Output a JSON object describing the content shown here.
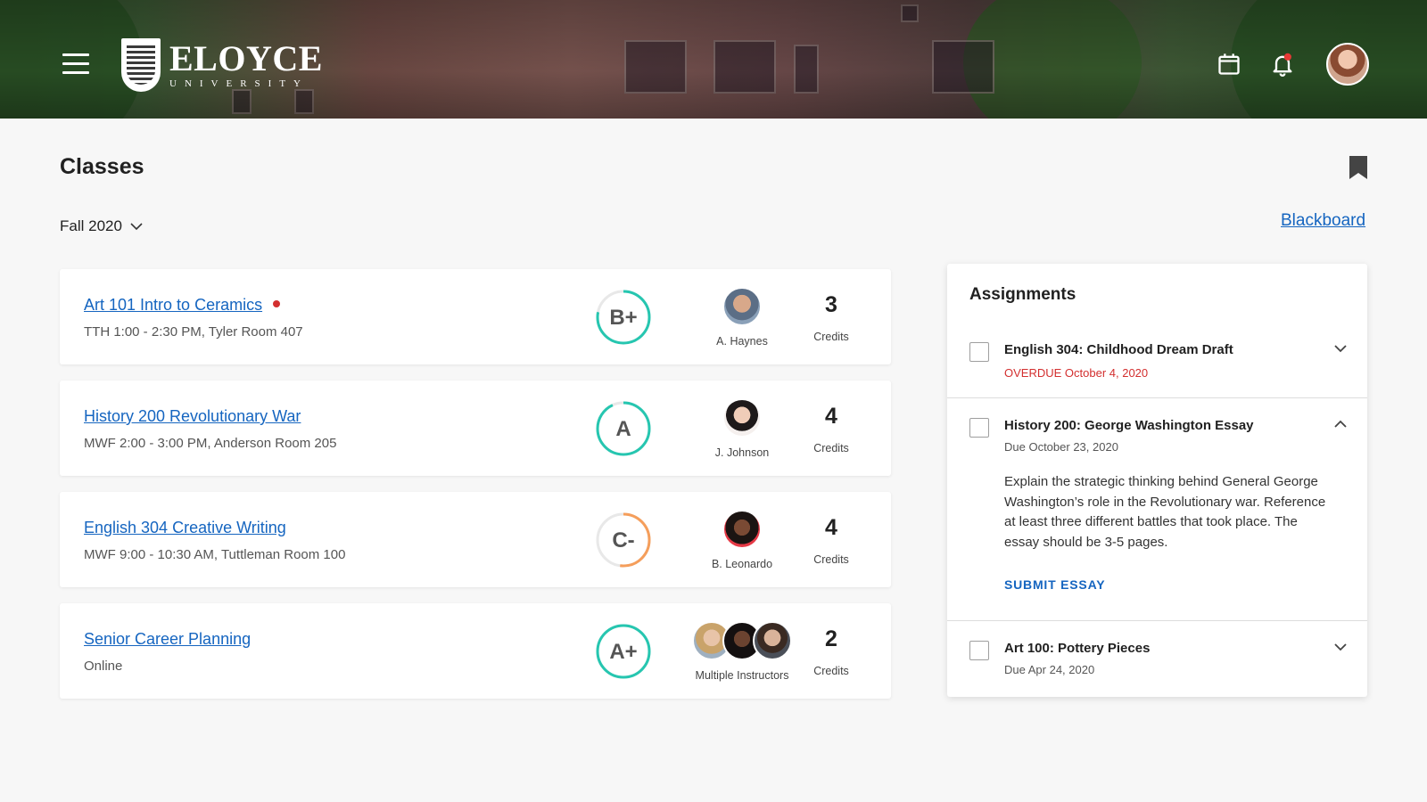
{
  "header": {
    "logo_name": "ELOYCE",
    "logo_sub": "UNIVERSITY"
  },
  "page": {
    "title": "Classes",
    "term": "Fall 2020",
    "blackboard_link": "Blackboard"
  },
  "classes": [
    {
      "name": "Art 101 Intro to Ceramics",
      "schedule": "TTH 1:00 - 2:30 PM, Tyler Room 407",
      "grade": "B+",
      "grade_progress": 0.78,
      "grade_color": "#26c6b0",
      "instructor": "A. Haynes",
      "credits": "3",
      "credits_label": "Credits",
      "has_alert": true
    },
    {
      "name": "History 200 Revolutionary War",
      "schedule": "MWF 2:00 - 3:00 PM, Anderson Room 205",
      "grade": "A",
      "grade_progress": 0.93,
      "grade_color": "#26c6b0",
      "instructor": "J. Johnson",
      "credits": "4",
      "credits_label": "Credits",
      "has_alert": false
    },
    {
      "name": "English 304 Creative Writing",
      "schedule": "MWF 9:00 - 10:30 AM, Tuttleman Room 100",
      "grade": "C-",
      "grade_progress": 0.52,
      "grade_color": "#f59e5b",
      "instructor": "B. Leonardo",
      "credits": "4",
      "credits_label": "Credits",
      "has_alert": false
    },
    {
      "name": "Senior Career Planning",
      "schedule": "Online",
      "grade": "A+",
      "grade_progress": 1.0,
      "grade_color": "#26c6b0",
      "instructor": "Multiple Instructors",
      "credits": "2",
      "credits_label": "Credits",
      "has_alert": false
    }
  ],
  "assignments": {
    "title": "Assignments",
    "items": [
      {
        "title": "English 304: Childhood Dream Draft",
        "due": "OVERDUE October 4, 2020",
        "overdue": true,
        "expanded": false
      },
      {
        "title": "History 200: George Washington Essay",
        "due": "Due October 23, 2020",
        "overdue": false,
        "expanded": true,
        "description": "Explain the strategic thinking behind General George Washington’s role in the Revolutionary war. Reference at least three different battles that took place. The essay should be 3-5 pages.",
        "action": "SUBMIT ESSAY"
      },
      {
        "title": "Art 100: Pottery Pieces",
        "due": "Due Apr 24, 2020",
        "overdue": false,
        "expanded": false
      }
    ]
  },
  "colors": {
    "link": "#1565c0",
    "overdue": "#d32f2f",
    "grade_good": "#26c6b0",
    "grade_warn": "#f59e5b"
  }
}
